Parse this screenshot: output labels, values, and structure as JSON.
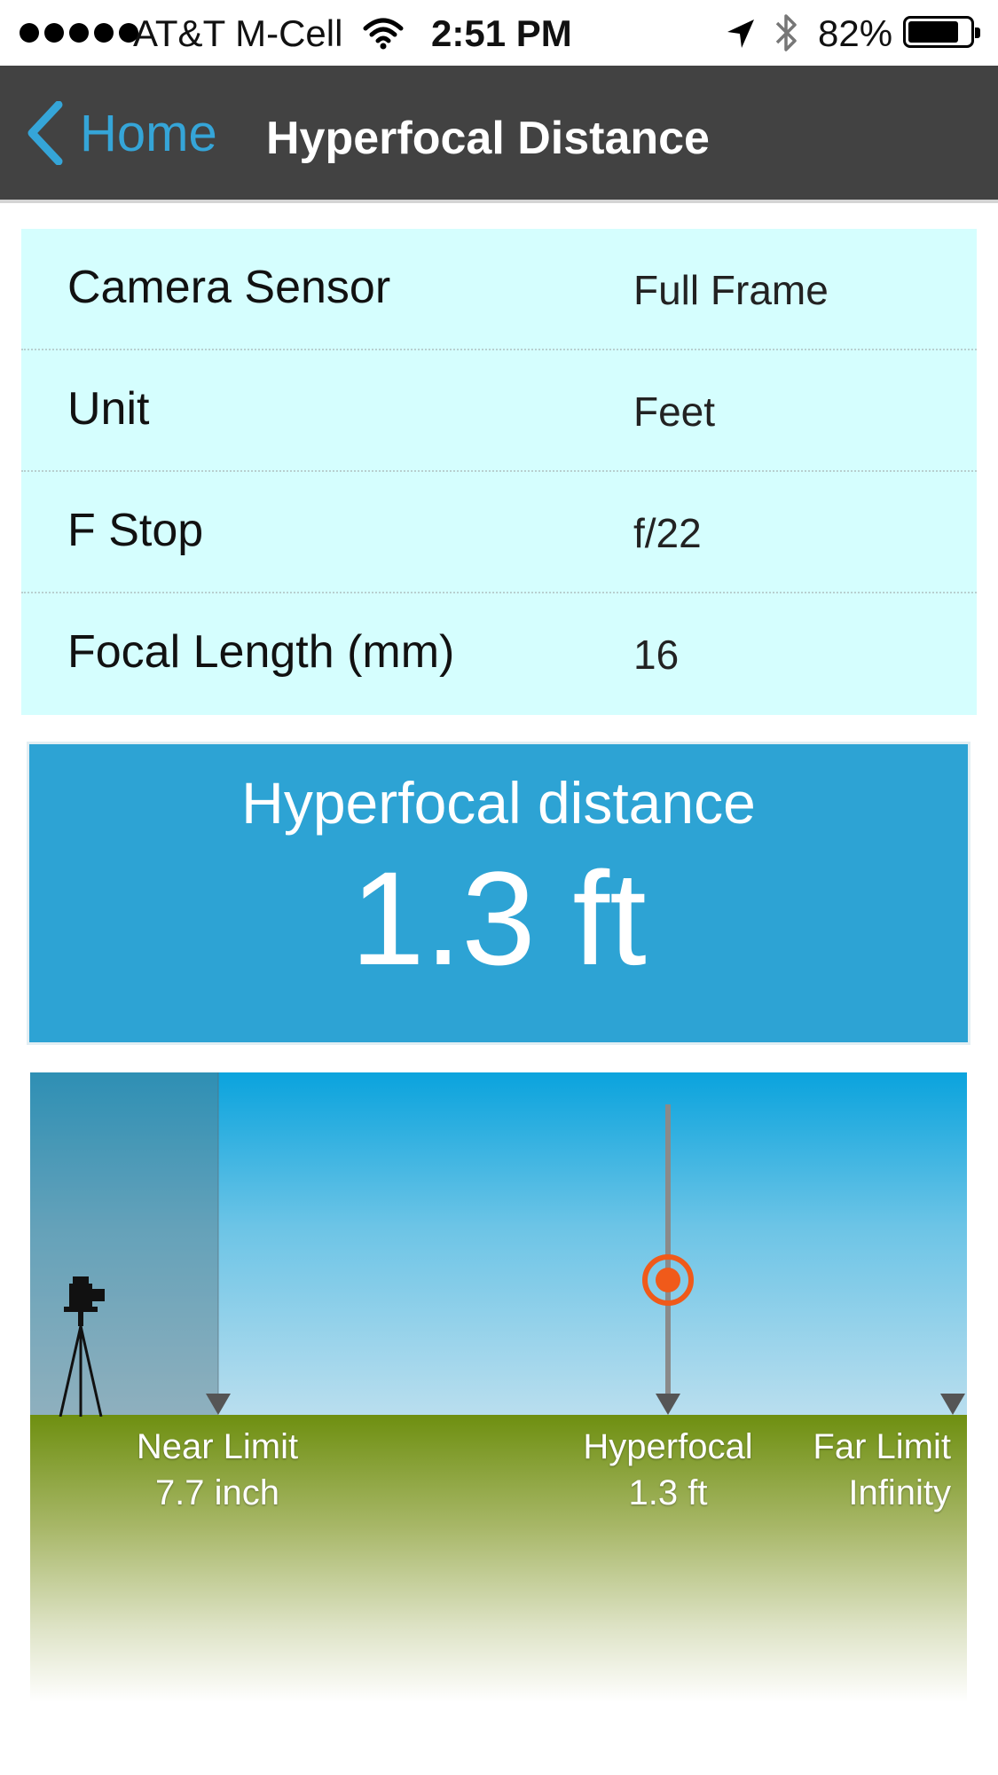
{
  "status_bar": {
    "carrier": "AT&T M-Cell",
    "time": "2:51 PM",
    "battery_percent": "82%",
    "battery_level": 0.82,
    "icons": [
      "signal-dots",
      "wifi-icon",
      "location-arrow-icon",
      "bluetooth-icon",
      "battery-icon"
    ]
  },
  "nav": {
    "back_label": "Home",
    "title": "Hyperfocal Distance",
    "accent_color": "#35a5d8",
    "bar_color": "#424242"
  },
  "settings": {
    "background_color": "#d5fefe",
    "rows": [
      {
        "label": "Camera Sensor",
        "value": "Full Frame"
      },
      {
        "label": "Unit",
        "value": "Feet"
      },
      {
        "label": "F Stop",
        "value": "f/22"
      },
      {
        "label": "Focal Length (mm)",
        "value": "16"
      }
    ]
  },
  "result": {
    "label": "Hyperfocal distance",
    "value": "1.3 ft",
    "background_color": "#2da3d4"
  },
  "diagram": {
    "near_limit": {
      "title": "Near Limit",
      "value": "7.7 inch"
    },
    "hyperfocal": {
      "title": "Hyperfocal",
      "value": "1.3 ft"
    },
    "far_limit": {
      "title": "Far Limit",
      "value": "Infinity"
    },
    "focus_marker_color": "#f05a1a",
    "ground_color": "#6e8f10"
  }
}
